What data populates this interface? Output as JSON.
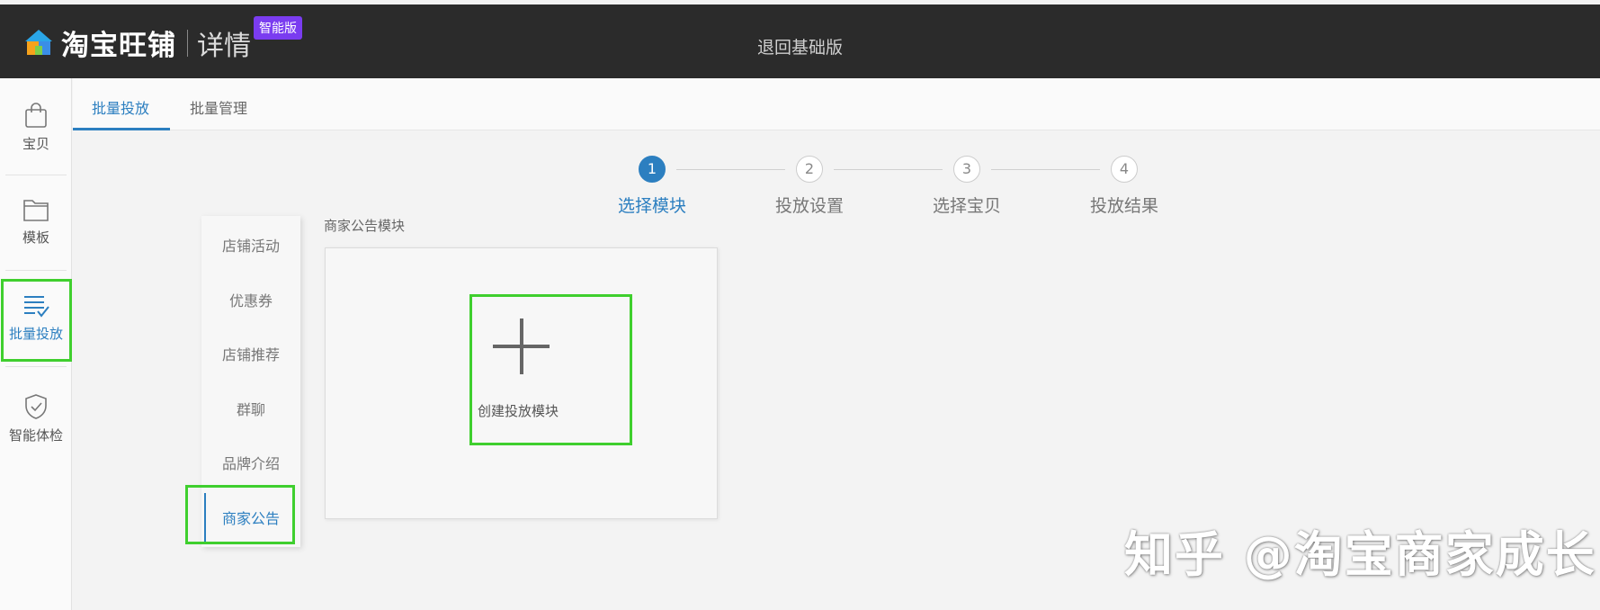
{
  "header": {
    "brand": "淘宝旺铺",
    "product": "详情",
    "edition_badge": "智能版",
    "back_link": "退回基础版"
  },
  "leftnav": {
    "items": [
      {
        "label": "宝贝",
        "icon": "bag-icon"
      },
      {
        "label": "模板",
        "icon": "folder-icon"
      },
      {
        "label": "批量投放",
        "icon": "list-check-icon"
      },
      {
        "label": "智能体检",
        "icon": "shield-check-icon"
      }
    ],
    "active_index": 2
  },
  "tabs": [
    {
      "label": "批量投放"
    },
    {
      "label": "批量管理"
    }
  ],
  "steps": [
    {
      "number": "1",
      "label": "选择模块"
    },
    {
      "number": "2",
      "label": "投放设置"
    },
    {
      "number": "3",
      "label": "选择宝贝"
    },
    {
      "number": "4",
      "label": "投放结果"
    }
  ],
  "submenu": {
    "items": [
      {
        "label": "店铺活动"
      },
      {
        "label": "优惠券"
      },
      {
        "label": "店铺推荐"
      },
      {
        "label": "群聊"
      },
      {
        "label": "品牌介绍"
      },
      {
        "label": "商家公告"
      }
    ],
    "active_index": 5
  },
  "content": {
    "section_title": "商家公告模块",
    "create_label": "创建投放模块"
  },
  "watermark": "知乎 @淘宝商家成长",
  "colors": {
    "accent": "#2c7fc0",
    "topbar": "#2b2b2b",
    "badge": "#7a3cf0",
    "highlight": "#3fcf2e"
  }
}
